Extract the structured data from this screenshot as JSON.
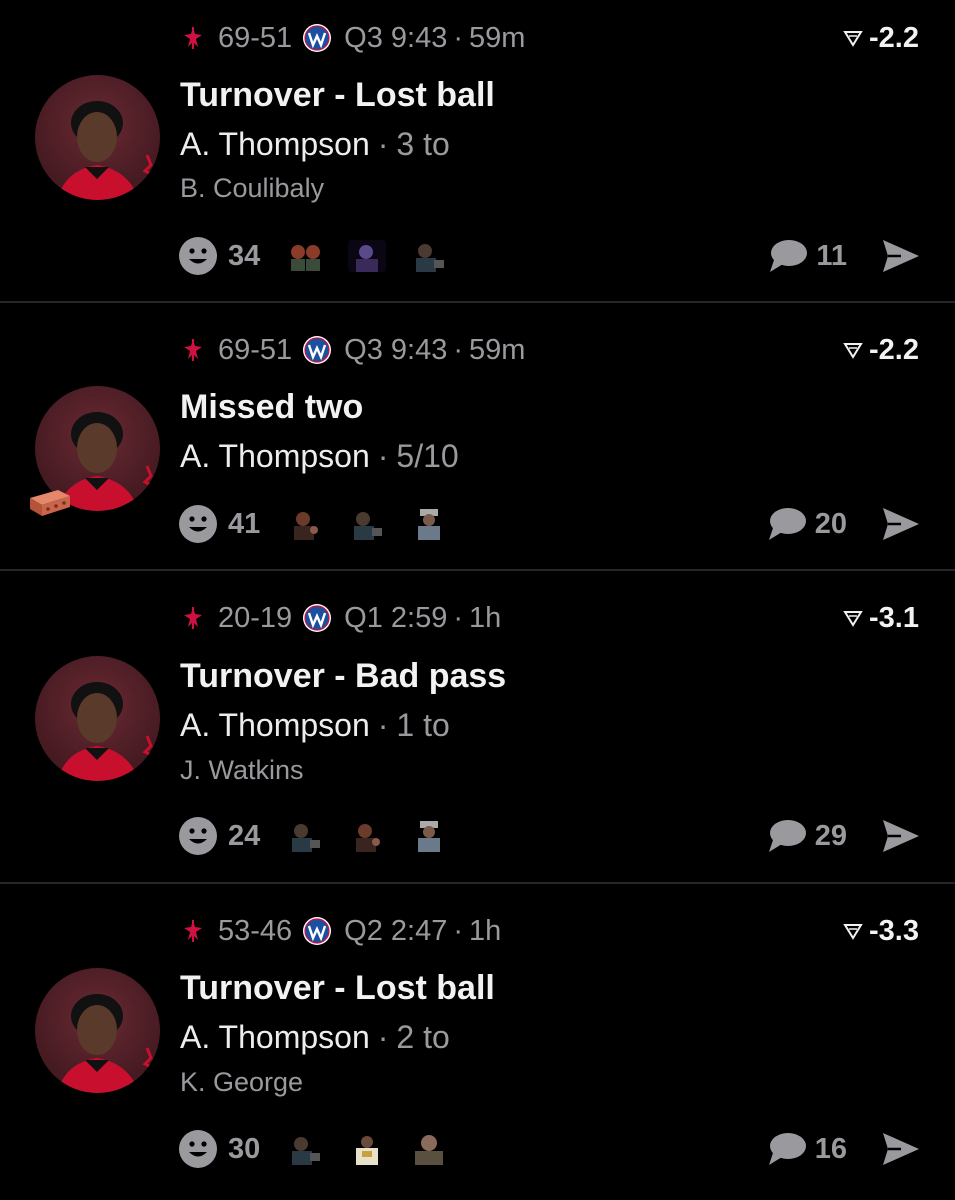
{
  "feed": {
    "items": [
      {
        "score": "69-51",
        "clock": "Q3 9:43",
        "age": "59m",
        "delta": "-2.2",
        "title": "Turnover - Lost ball",
        "player": "A. Thompson",
        "stat": "3 to",
        "secondary": "B. Coulibaly",
        "reaction_count": "34",
        "comment_count": "11",
        "badge": ""
      },
      {
        "score": "69-51",
        "clock": "Q3 9:43",
        "age": "59m",
        "delta": "-2.2",
        "title": "Missed two",
        "player": "A. Thompson",
        "stat": "5/10",
        "secondary": "",
        "reaction_count": "41",
        "comment_count": "20",
        "badge": "brick-icon"
      },
      {
        "score": "20-19",
        "clock": "Q1 2:59",
        "age": "1h",
        "delta": "-3.1",
        "title": "Turnover - Bad pass",
        "player": "A. Thompson",
        "stat": "1 to",
        "secondary": "J. Watkins",
        "reaction_count": "24",
        "comment_count": "29",
        "badge": ""
      },
      {
        "score": "53-46",
        "clock": "Q2 2:47",
        "age": "1h",
        "delta": "-3.3",
        "title": "Turnover - Lost ball",
        "player": "A. Thompson",
        "stat": "2 to",
        "secondary": "K. George",
        "reaction_count": "30",
        "comment_count": "16",
        "badge": ""
      }
    ]
  },
  "separators": {
    "dot": "·"
  },
  "icons": {
    "home_team": "rockets-logo-icon",
    "away_team": "wizards-logo-icon",
    "delta": "down-triangle-icon",
    "reaction": "smiley-icon",
    "comment": "speech-bubble-icon",
    "share": "send-icon"
  },
  "colors": {
    "background": "#000000",
    "text_primary": "#f2f2f2",
    "text_secondary": "#9a9a9e",
    "rockets_red": "#ce1141",
    "wizards_blue": "#1b4fa0",
    "avatar_bg": "#4a1c24"
  }
}
